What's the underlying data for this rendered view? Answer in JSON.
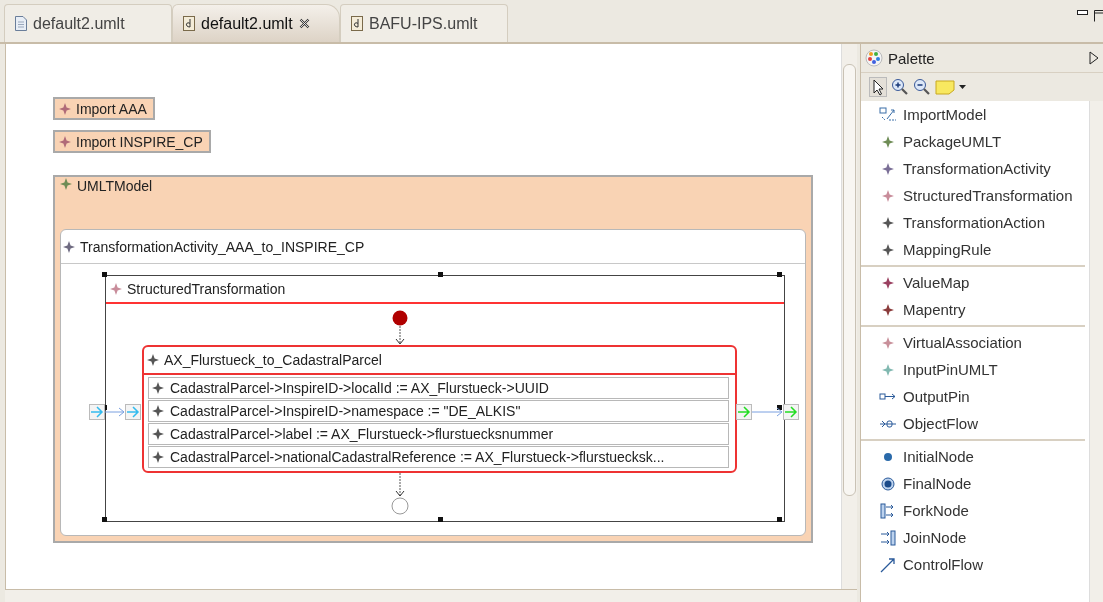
{
  "tabs": [
    {
      "label": "default2.umlt",
      "selected": false
    },
    {
      "label": "default2.umlt",
      "selected": true
    },
    {
      "label": "BAFU-IPS.umlt",
      "selected": false
    }
  ],
  "diagram": {
    "imports": [
      "Import AAA",
      "Import INSPIRE_CP"
    ],
    "model": {
      "title": "UMLTModel",
      "activity": {
        "title": "TransformationActivity_AAA_to_INSPIRE_CP",
        "structured": {
          "title": "StructuredTransformation",
          "action": {
            "title": "AX_Flurstueck_to_CadastralParcel",
            "rules": [
              "CadastralParcel->InspireID->localId := AX_Flurstueck->UUID",
              "CadastralParcel->InspireID->namespace := \"DE_ALKIS\"",
              "CadastralParcel->label := AX_Flurstueck->flurstuecksnummer",
              "CadastralParcel->nationalCadastralReference := AX_Flurstueck->flurstuecksk..."
            ]
          }
        }
      }
    }
  },
  "palette": {
    "title": "Palette",
    "groups": [
      {
        "items": [
          {
            "label": "ImportModel",
            "kind": "import"
          },
          {
            "label": "PackageUMLT",
            "kind": "diamond",
            "color": "#6e8c55"
          },
          {
            "label": "TransformationActivity",
            "kind": "diamond",
            "color": "#7a6e96"
          },
          {
            "label": "StructuredTransformation",
            "kind": "diamond",
            "color": "#c88c9a"
          },
          {
            "label": "TransformationAction",
            "kind": "diamond",
            "color": "#555555"
          },
          {
            "label": "MappingRule",
            "kind": "diamond",
            "color": "#555555"
          }
        ]
      },
      {
        "items": [
          {
            "label": "ValueMap",
            "kind": "diamond",
            "color": "#9a4060"
          },
          {
            "label": "Mapentry",
            "kind": "diamond",
            "color": "#8a3a3a"
          }
        ]
      },
      {
        "items": [
          {
            "label": "VirtualAssociation",
            "kind": "diamond",
            "color": "#c8909a"
          },
          {
            "label": "InputPinUMLT",
            "kind": "diamond",
            "color": "#80b8b0"
          },
          {
            "label": "OutputPin",
            "kind": "output-pin"
          },
          {
            "label": "ObjectFlow",
            "kind": "object-flow"
          }
        ]
      },
      {
        "items": [
          {
            "label": "InitialNode",
            "kind": "initial"
          },
          {
            "label": "FinalNode",
            "kind": "final"
          },
          {
            "label": "ForkNode",
            "kind": "fork"
          },
          {
            "label": "JoinNode",
            "kind": "join"
          },
          {
            "label": "ControlFlow",
            "kind": "control-flow"
          }
        ]
      }
    ]
  }
}
